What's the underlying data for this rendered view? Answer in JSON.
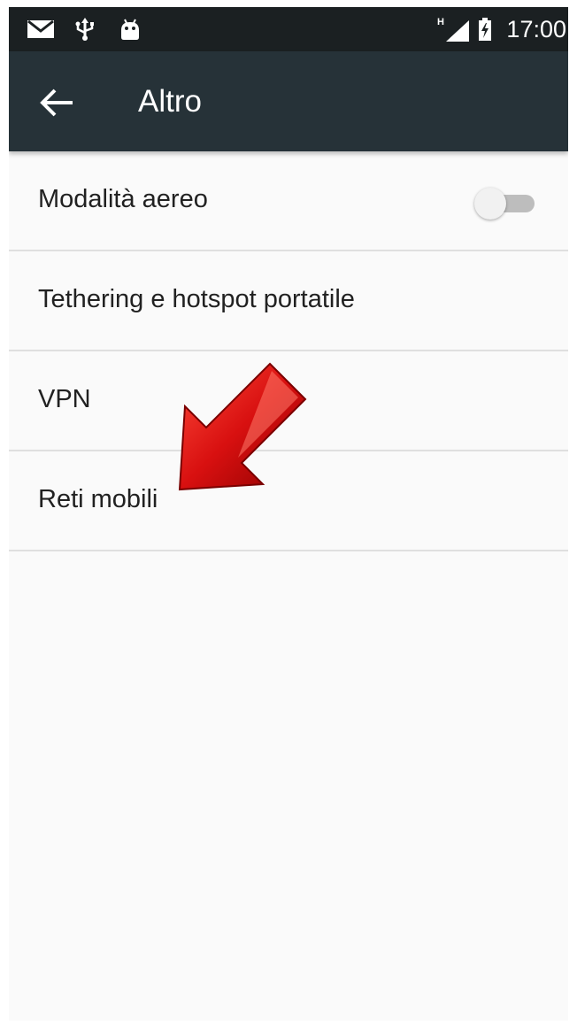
{
  "status_bar": {
    "time": "17:00",
    "network_type": "H",
    "icons": [
      "mail-icon",
      "usb-icon",
      "android-icon",
      "signal-icon",
      "battery-charging-icon"
    ]
  },
  "app_bar": {
    "back_icon": "arrow-back-icon",
    "title": "Altro"
  },
  "list": {
    "items": [
      {
        "label": "Modalità aereo",
        "toggle": "off"
      },
      {
        "label": "Tethering e hotspot portatile"
      },
      {
        "label": "VPN"
      },
      {
        "label": "Reti mobili"
      }
    ]
  },
  "colors": {
    "status_bar": "#1b2022",
    "app_bar": "#263238",
    "background": "#fafafa",
    "divider": "#dfdfdf",
    "text": "#212121",
    "annotation_arrow": "#d01010"
  }
}
